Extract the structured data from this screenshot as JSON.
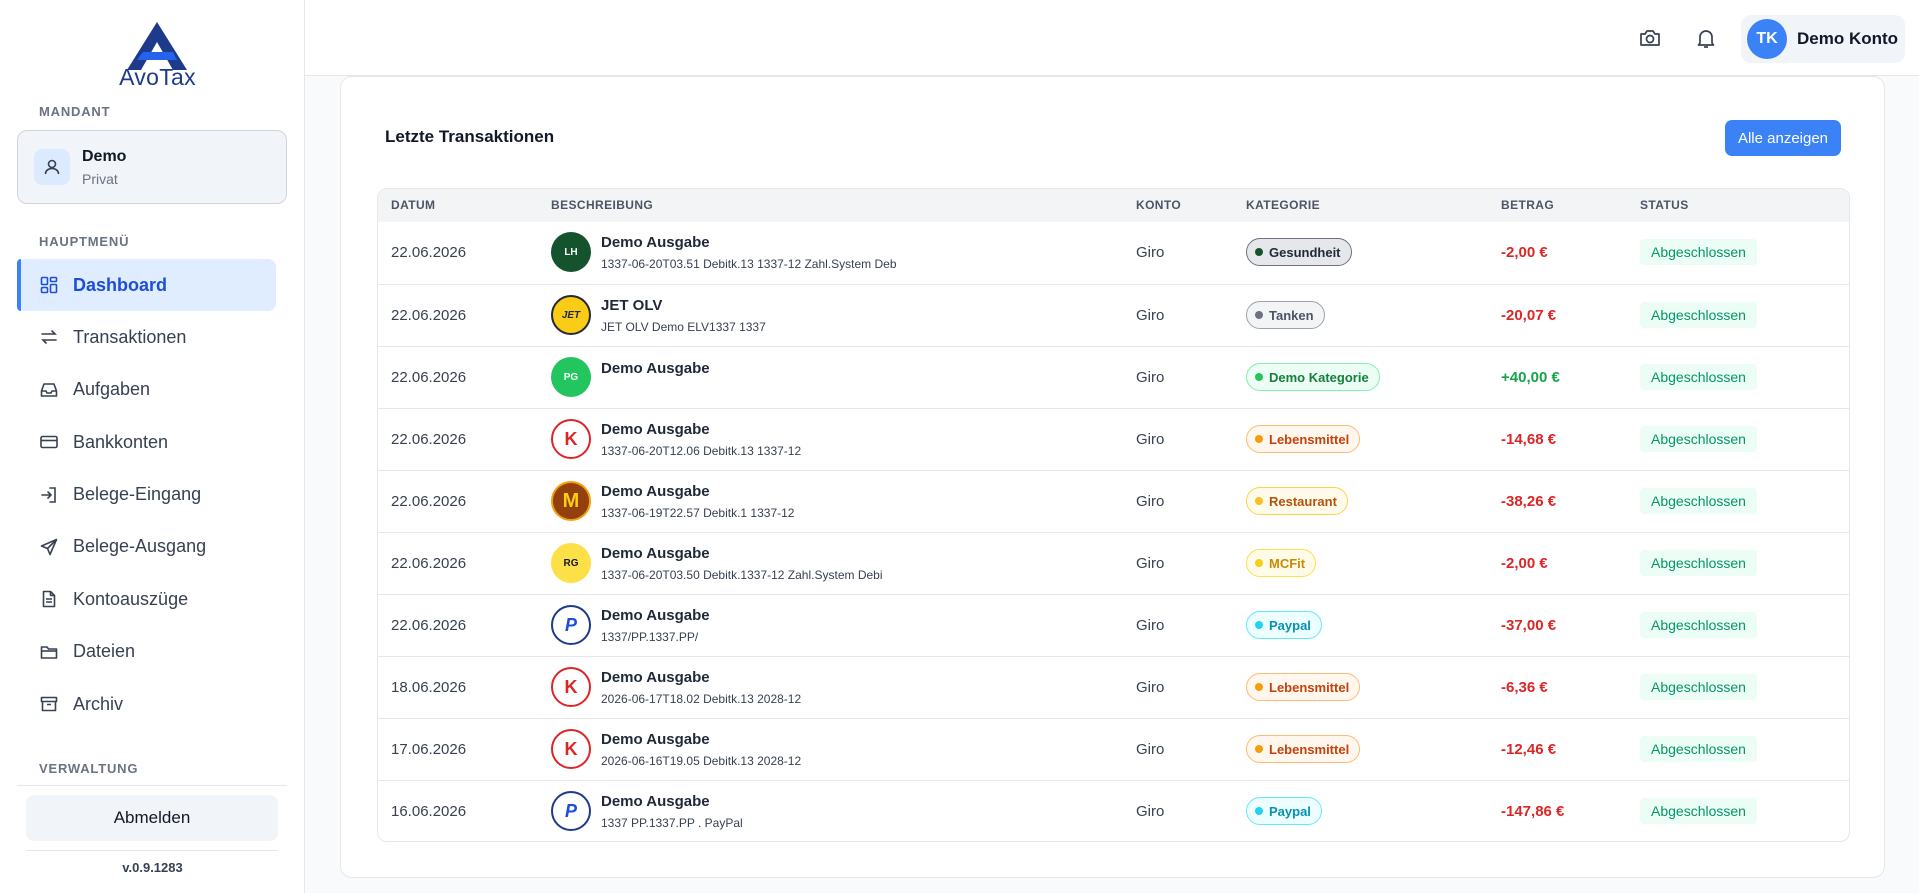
{
  "brand": {
    "name": "AvoTax"
  },
  "sidebar": {
    "mandant_label": "MANDANT",
    "mandant": {
      "name": "Demo",
      "type": "Privat"
    },
    "menu_label": "HAUPTMENÜ",
    "items": [
      {
        "label": "Dashboard",
        "icon": "dashboard-icon",
        "active": true
      },
      {
        "label": "Transaktionen",
        "icon": "transfer-icon"
      },
      {
        "label": "Aufgaben",
        "icon": "inbox-icon"
      },
      {
        "label": "Bankkonten",
        "icon": "credit-card-icon"
      },
      {
        "label": "Belege-Eingang",
        "icon": "login-icon"
      },
      {
        "label": "Belege-Ausgang",
        "icon": "send-icon"
      },
      {
        "label": "Kontoauszüge",
        "icon": "document-icon"
      },
      {
        "label": "Dateien",
        "icon": "folder-icon"
      },
      {
        "label": "Archiv",
        "icon": "archive-icon"
      }
    ],
    "admin_label": "VERWALTUNG",
    "logout_label": "Abmelden",
    "version": "v.0.9.1283"
  },
  "header": {
    "user": {
      "initials": "TK",
      "name": "Demo Konto"
    }
  },
  "card": {
    "title": "Letzte Transaktionen",
    "show_all_label": "Alle anzeigen"
  },
  "table": {
    "columns": [
      "DATUM",
      "BESCHREIBUNG",
      "KONTO",
      "KATEGORIE",
      "BETRAG",
      "STATUS"
    ],
    "rows": [
      {
        "date": "22.06.2026",
        "logo": "LH",
        "title": "Demo Ausgabe",
        "sub": "1337-06-20T03.51 Debitk.13 1337-12 Zahl.System Deb",
        "konto": "Giro",
        "category": "Gesundheit",
        "amount": "-2,00 €",
        "status": "Abgeschlossen"
      },
      {
        "date": "22.06.2026",
        "logo": "JET",
        "title": "JET OLV",
        "sub": "JET OLV Demo ELV1337 1337",
        "konto": "Giro",
        "category": "Tanken",
        "amount": "-20,07 €",
        "status": "Abgeschlossen"
      },
      {
        "date": "22.06.2026",
        "logo": "PG",
        "title": "Demo Ausgabe",
        "sub": "",
        "konto": "Giro",
        "category": "Demo Kategorie",
        "amount": "+40,00 €",
        "status": "Abgeschlossen"
      },
      {
        "date": "22.06.2026",
        "logo": "K",
        "title": "Demo Ausgabe",
        "sub": "1337-06-20T12.06 Debitk.13 1337-12",
        "konto": "Giro",
        "category": "Lebensmittel",
        "amount": "-14,68 €",
        "status": "Abgeschlossen"
      },
      {
        "date": "22.06.2026",
        "logo": "M",
        "title": "Demo Ausgabe",
        "sub": "1337-06-19T22.57 Debitk.1 1337-12",
        "konto": "Giro",
        "category": "Restaurant",
        "amount": "-38,26 €",
        "status": "Abgeschlossen"
      },
      {
        "date": "22.06.2026",
        "logo": "RG",
        "title": "Demo Ausgabe",
        "sub": "1337-06-20T03.50 Debitk.1337-12 Zahl.System Debi",
        "konto": "Giro",
        "category": "MCFit",
        "amount": "-2,00 €",
        "status": "Abgeschlossen"
      },
      {
        "date": "22.06.2026",
        "logo": "P",
        "title": "Demo Ausgabe",
        "sub": "1337/PP.1337.PP/",
        "konto": "Giro",
        "category": "Paypal",
        "amount": "-37,00 €",
        "status": "Abgeschlossen"
      },
      {
        "date": "18.06.2026",
        "logo": "K",
        "title": "Demo Ausgabe",
        "sub": "2026-06-17T18.02 Debitk.13 2028-12",
        "konto": "Giro",
        "category": "Lebensmittel",
        "amount": "-6,36 €",
        "status": "Abgeschlossen"
      },
      {
        "date": "17.06.2026",
        "logo": "K",
        "title": "Demo Ausgabe",
        "sub": "2026-06-16T19.05 Debitk.13 2028-12",
        "konto": "Giro",
        "category": "Lebensmittel",
        "amount": "-12,46 €",
        "status": "Abgeschlossen"
      },
      {
        "date": "16.06.2026",
        "logo": "P",
        "title": "Demo Ausgabe",
        "sub": "1337 PP.1337.PP . PayPal",
        "konto": "Giro",
        "category": "Paypal",
        "amount": "-147,86 €",
        "status": "Abgeschlossen"
      }
    ]
  },
  "colors": {
    "accent": "#3b82f6",
    "negative": "#dc2626",
    "positive": "#16a34a",
    "status_ok": "#059669"
  }
}
